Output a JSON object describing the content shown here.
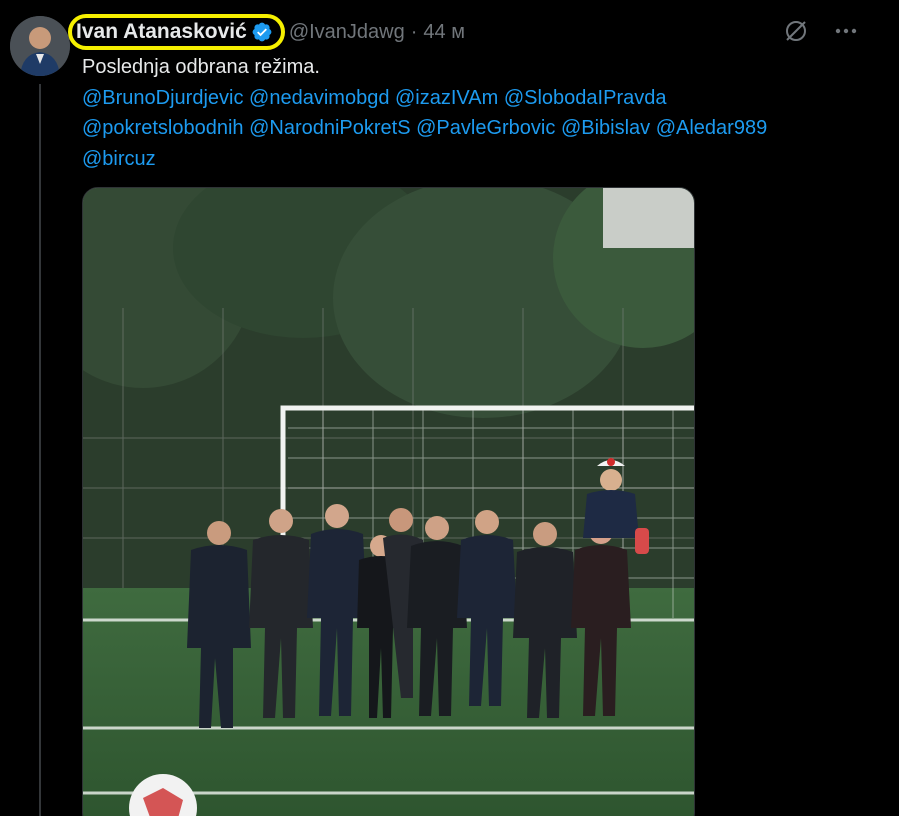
{
  "tweet": {
    "author_name": "Ivan Atanasković",
    "handle": "@IvanJdawg",
    "separator": "·",
    "time": "44 м",
    "text": "Poslednja odbrana režima.",
    "mentions": [
      "@BrunoDjurdjevic",
      "@nedavimobgd",
      "@izazIVAm",
      "@SlobodaIPravda",
      "@pokretslobodnih",
      "@NarodniPokretS",
      "@PavleGrbovic",
      "@Bibislav",
      "@Aledar989",
      "@bircuz"
    ]
  },
  "icons": {
    "verified": "verified-badge-icon",
    "grok": "grok-icon",
    "more": "more-icon"
  },
  "colors": {
    "background": "#000000",
    "text": "#e7e9ea",
    "muted": "#71767b",
    "link": "#1d9bf0",
    "highlight": "#f6f000"
  }
}
